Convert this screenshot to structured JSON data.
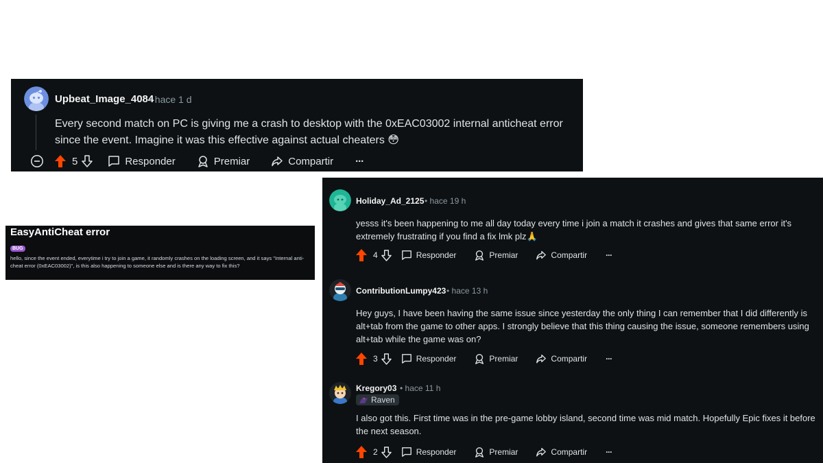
{
  "main_comment": {
    "username": "Upbeat_Image_4084",
    "time": "hace 1 d",
    "body": "Every second match on PC is giving me a crash to desktop with the 0xEAC03002 internal anticheat error since the event. Imagine it was this effective against actual cheaters 😳",
    "votes": "5",
    "reply_label": "Responder",
    "award_label": "Premiar",
    "share_label": "Compartir",
    "more": "···"
  },
  "post": {
    "title": "EasyAntiCheat error",
    "flair": "BUG",
    "body": "hello, since the event ended, everytime i try to join a game, it randomly crashes on the loading screen, and it says \"Internal anti-cheat error (0xEAC03002)\", is this also happening to someone else and is there any way to fix this?"
  },
  "replies": [
    {
      "username": "Holiday_Ad_2125",
      "time": "hace 19 h",
      "body": "yesss it's been happening to me all day today every time i join a match it crashes and gives that same error it's extremely frustrating if you find a fix lmk plz🙏",
      "votes": "4",
      "reply_label": "Responder",
      "award_label": "Premiar",
      "share_label": "Compartir",
      "more": "···"
    },
    {
      "username": "ContributionLumpy423",
      "time": "hace 13 h",
      "body": "Hey guys, I have been having the same issue since yesterday the only thing I can remember that I did differently is alt+tab from the game to other apps. I strongly believe that this thing causing the issue, someone remembers using alt+tab while the game was on?",
      "votes": "3",
      "reply_label": "Responder",
      "award_label": "Premiar",
      "share_label": "Compartir",
      "more": "···"
    },
    {
      "username": "Kregory03",
      "time": "hace 11 h",
      "user_flair": "Raven",
      "body": "I also got this. First time was in the pre-game lobby island, second time was mid match. Hopefully Epic fixes it before the next season.",
      "votes": "2",
      "reply_label": "Responder",
      "award_label": "Premiar",
      "share_label": "Compartir",
      "more": "···"
    }
  ],
  "colors": {
    "panel_bg": "#0e1113",
    "upvote_active": "#ff4500",
    "flair_purple": "#9b59d0",
    "meta_gray": "#8a9aa4"
  }
}
